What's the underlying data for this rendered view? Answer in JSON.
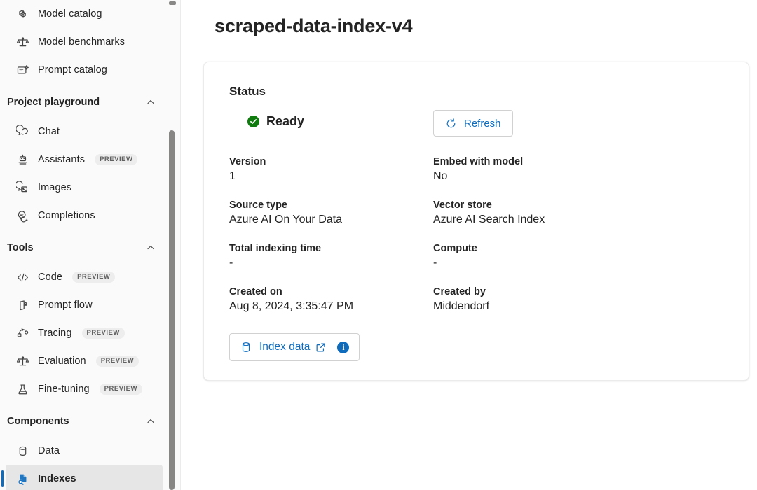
{
  "sidebar": {
    "items": [
      {
        "type": "link",
        "label": "Model catalog",
        "icon": "cube-stack-icon",
        "badge": null,
        "selected": false
      },
      {
        "type": "link",
        "label": "Model benchmarks",
        "icon": "scales-balance-icon",
        "badge": null,
        "selected": false
      },
      {
        "type": "link",
        "label": "Prompt catalog",
        "icon": "prompt-sparkle-icon",
        "badge": null,
        "selected": false
      },
      {
        "type": "group",
        "label": "Project playground",
        "icon": "chevron-up-icon",
        "badge": null,
        "selected": false
      },
      {
        "type": "link",
        "label": "Chat",
        "icon": "chat-bubble-icon",
        "badge": null,
        "selected": false
      },
      {
        "type": "link",
        "label": "Assistants",
        "icon": "robot-icon",
        "badge": "PREVIEW",
        "selected": false
      },
      {
        "type": "link",
        "label": "Images",
        "icon": "image-bubble-icon",
        "badge": null,
        "selected": false
      },
      {
        "type": "link",
        "label": "Completions",
        "icon": "completions-icon",
        "badge": null,
        "selected": false
      },
      {
        "type": "group",
        "label": "Tools",
        "icon": "chevron-up-icon",
        "badge": null,
        "selected": false
      },
      {
        "type": "link",
        "label": "Code",
        "icon": "code-brackets-icon",
        "badge": "PREVIEW",
        "selected": false
      },
      {
        "type": "link",
        "label": "Prompt flow",
        "icon": "prompt-flow-icon",
        "badge": null,
        "selected": false
      },
      {
        "type": "link",
        "label": "Tracing",
        "icon": "tracing-icon",
        "badge": "PREVIEW",
        "selected": false
      },
      {
        "type": "link",
        "label": "Evaluation",
        "icon": "scales-balance-icon",
        "badge": "PREVIEW",
        "selected": false
      },
      {
        "type": "link",
        "label": "Fine-tuning",
        "icon": "flask-icon",
        "badge": "PREVIEW",
        "selected": false
      },
      {
        "type": "group",
        "label": "Components",
        "icon": "chevron-up-icon",
        "badge": null,
        "selected": false
      },
      {
        "type": "link",
        "label": "Data",
        "icon": "database-icon",
        "badge": null,
        "selected": false
      },
      {
        "type": "link",
        "label": "Indexes",
        "icon": "index-search-icon",
        "badge": null,
        "selected": true
      }
    ],
    "scrollbar": {
      "up_arrow": "scroll-up-arrow"
    }
  },
  "main": {
    "page_title": "scraped-data-index-v4",
    "card": {
      "section_title": "Status",
      "status": {
        "text": "Ready",
        "icon": "checkmark-circle-icon",
        "color": "#107c10"
      },
      "refresh_button": {
        "label": "Refresh",
        "icon": "refresh-arrow-icon"
      },
      "fields": [
        {
          "label": "Version",
          "value": "1"
        },
        {
          "label": "Embed with model",
          "value": "No"
        },
        {
          "label": "Source type",
          "value": "Azure AI On Your Data"
        },
        {
          "label": "Vector store",
          "value": "Azure AI Search Index"
        },
        {
          "label": "Total indexing time",
          "value": "-"
        },
        {
          "label": "Compute",
          "value": "-"
        },
        {
          "label": "Created on",
          "value": "Aug 8, 2024, 3:35:47 PM"
        },
        {
          "label": "Created by",
          "value": "Middendorf"
        }
      ],
      "index_data_button": {
        "label": "Index data",
        "leading_icon": "database-icon",
        "trailing_icon": "open-in-new-icon",
        "info_icon": "info-circle-icon",
        "info_glyph": "i"
      }
    }
  },
  "colors": {
    "accent": "#0f6cbd",
    "success": "#107c10",
    "sidebar_bg": "#fafafa",
    "selected_bg": "#e6e6e6",
    "border": "#d1d1d1",
    "card_border": "#ebebeb"
  }
}
